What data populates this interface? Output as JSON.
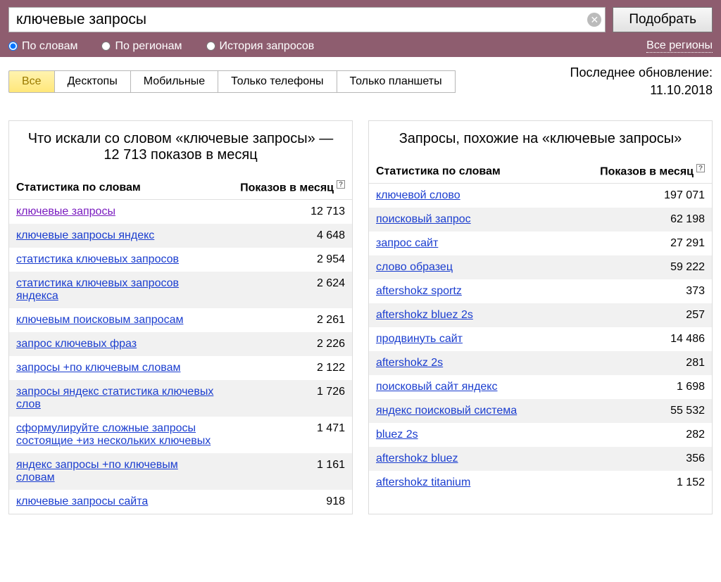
{
  "search": {
    "value": "ключевые запросы",
    "submit_label": "Подобрать"
  },
  "filters": {
    "by_words": "По словам",
    "by_regions": "По регионам",
    "history": "История запросов",
    "all_regions": "Все регионы"
  },
  "tabs": {
    "all": "Все",
    "desktops": "Десктопы",
    "mobile": "Мобильные",
    "phones": "Только телефоны",
    "tablets": "Только планшеты"
  },
  "updated": {
    "label": "Последнее обновление:",
    "date": "11.10.2018"
  },
  "table_headers": {
    "stat": "Статистика по словам",
    "shows": "Показов в месяц"
  },
  "left": {
    "title": "Что искали со словом «ключевые запросы» — 12 713 показов в месяц",
    "rows": [
      {
        "q": "ключевые запросы",
        "n": "12 713",
        "visited": true
      },
      {
        "q": "ключевые запросы яндекс",
        "n": "4 648"
      },
      {
        "q": "статистика ключевых запросов",
        "n": "2 954"
      },
      {
        "q": "статистика ключевых запросов яндекса",
        "n": "2 624"
      },
      {
        "q": "ключевым поисковым запросам",
        "n": "2 261"
      },
      {
        "q": "запрос ключевых фраз",
        "n": "2 226"
      },
      {
        "q": "запросы +по ключевым словам",
        "n": "2 122"
      },
      {
        "q": "запросы яндекс статистика ключевых слов",
        "n": "1 726"
      },
      {
        "q": "сформулируйте сложные запросы состоящие +из нескольких ключевых",
        "n": "1 471"
      },
      {
        "q": "яндекс запросы +по ключевым словам",
        "n": "1 161"
      },
      {
        "q": "ключевые запросы сайта",
        "n": "918"
      }
    ]
  },
  "right": {
    "title": "Запросы, похожие на «ключевые запросы»",
    "rows": [
      {
        "q": "ключевой слово",
        "n": "197 071"
      },
      {
        "q": "поисковый запрос",
        "n": "62 198"
      },
      {
        "q": "запрос сайт",
        "n": "27 291"
      },
      {
        "q": "слово образец",
        "n": "59 222"
      },
      {
        "q": "aftershokz sportz",
        "n": "373"
      },
      {
        "q": "aftershokz bluez 2s",
        "n": "257"
      },
      {
        "q": "продвинуть сайт",
        "n": "14 486"
      },
      {
        "q": "aftershokz 2s",
        "n": "281"
      },
      {
        "q": "поисковый сайт яндекс",
        "n": "1 698"
      },
      {
        "q": "яндекс поисковый система",
        "n": "55 532"
      },
      {
        "q": "bluez 2s",
        "n": "282"
      },
      {
        "q": "aftershokz bluez",
        "n": "356"
      },
      {
        "q": "aftershokz titanium",
        "n": "1 152"
      }
    ]
  }
}
